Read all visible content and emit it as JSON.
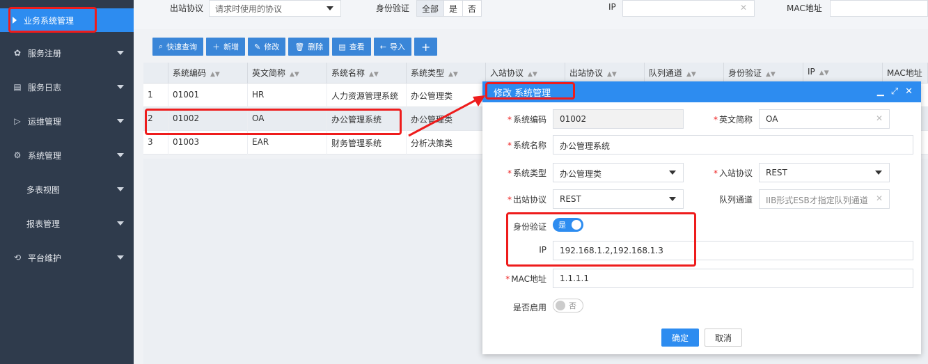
{
  "sidebar": {
    "active": "业务系统管理",
    "items": [
      {
        "label": "服务注册",
        "icon": "cluster-icon"
      },
      {
        "label": "服务日志",
        "icon": "document-icon"
      },
      {
        "label": "运维管理",
        "icon": "play-circle-icon"
      },
      {
        "label": "系统管理",
        "icon": "gear-icon"
      },
      {
        "label": "多表视图",
        "icon": ""
      },
      {
        "label": "报表管理",
        "icon": ""
      },
      {
        "label": "平台维护",
        "icon": "refresh-icon"
      }
    ]
  },
  "filters": {
    "outbound_label": "出站协议",
    "outbound_placeholder": "请求时使用的协议",
    "auth_label": "身份验证",
    "auth_options": [
      "全部",
      "是",
      "否"
    ],
    "auth_selected": "全部",
    "ip_label": "IP",
    "mac_label": "MAC地址"
  },
  "toolbar": {
    "quick_query": "快速查询",
    "add": "新增",
    "edit": "修改",
    "delete": "删除",
    "view": "查看",
    "import": "导入",
    "plus": "+"
  },
  "table": {
    "headers": [
      "系统编码",
      "英文简称",
      "系统名称",
      "系统类型",
      "入站协议",
      "出站协议",
      "队列通道",
      "身份验证",
      "IP",
      "MAC地址"
    ],
    "rows": [
      {
        "idx": "1",
        "code": "01001",
        "abbr": "HR",
        "name": "人力资源管理系统",
        "type": "办公管理类"
      },
      {
        "idx": "2",
        "code": "01002",
        "abbr": "OA",
        "name": "办公管理系统",
        "type": "办公管理类"
      },
      {
        "idx": "3",
        "code": "01003",
        "abbr": "EAR",
        "name": "财务管理系统",
        "type": "分析决策类"
      }
    ]
  },
  "modal": {
    "title": "修改 系统管理",
    "fields": {
      "code_label": "系统编码",
      "code_value": "01002",
      "abbr_label": "英文简称",
      "abbr_value": "OA",
      "name_label": "系统名称",
      "name_value": "办公管理系统",
      "type_label": "系统类型",
      "type_value": "办公管理类",
      "inbound_label": "入站协议",
      "inbound_value": "REST",
      "outbound_label": "出站协议",
      "outbound_value": "REST",
      "queue_label": "队列通道",
      "queue_placeholder": "IIB形式ESB才指定队列通道",
      "auth_label": "身份验证",
      "auth_value": "是",
      "ip_label": "IP",
      "ip_value": "192.168.1.2,192.168.1.3",
      "mac_label": "MAC地址",
      "mac_value": "1.1.1.1",
      "enabled_label": "是否启用",
      "enabled_value": "否"
    },
    "ok": "确定",
    "cancel": "取消"
  },
  "colors": {
    "accent": "#2d8cf0",
    "sidebar": "#2f3b4c",
    "annotation": "#ee1c1c"
  }
}
